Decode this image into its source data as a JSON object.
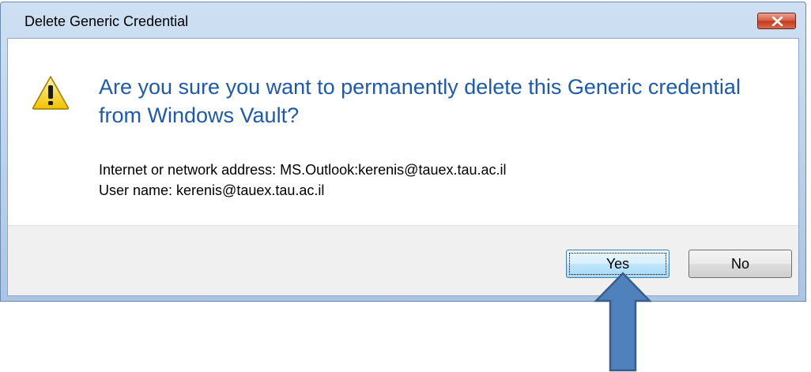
{
  "window": {
    "title": "Delete Generic Credential",
    "close_icon": "close-icon"
  },
  "dialog": {
    "icon": "warning-icon",
    "main_instruction": "Are you sure you want to permanently delete this Generic credential from Windows Vault?",
    "details": [
      "Internet or network address: MS.Outlook:kerenis@tauex.tau.ac.il",
      "User name: kerenis@tauex.tau.ac.il"
    ]
  },
  "buttons": {
    "yes_label": "Yes",
    "no_label": "No"
  },
  "annotation": {
    "icon": "up-arrow-icon",
    "color": "#4f81bd"
  },
  "colors": {
    "instruction_text": "#1e5aa8",
    "close_button": "#c23a20"
  }
}
